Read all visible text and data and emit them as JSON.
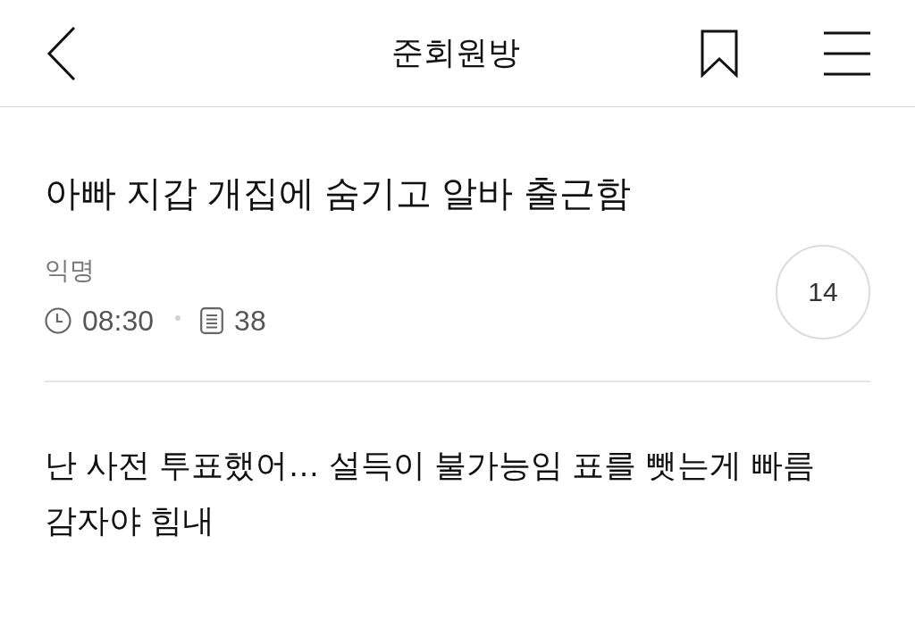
{
  "header": {
    "title": "준회원방"
  },
  "post": {
    "title": "아빠 지갑 개집에 숨기고 알바 출근함",
    "author": "익명",
    "time": "08:30",
    "count": "38",
    "circle_count": "14"
  },
  "body": {
    "text": "난 사전 투표했어… 설득이 불가능임 표를 뺏는게 빠름 감자야 힘내"
  }
}
